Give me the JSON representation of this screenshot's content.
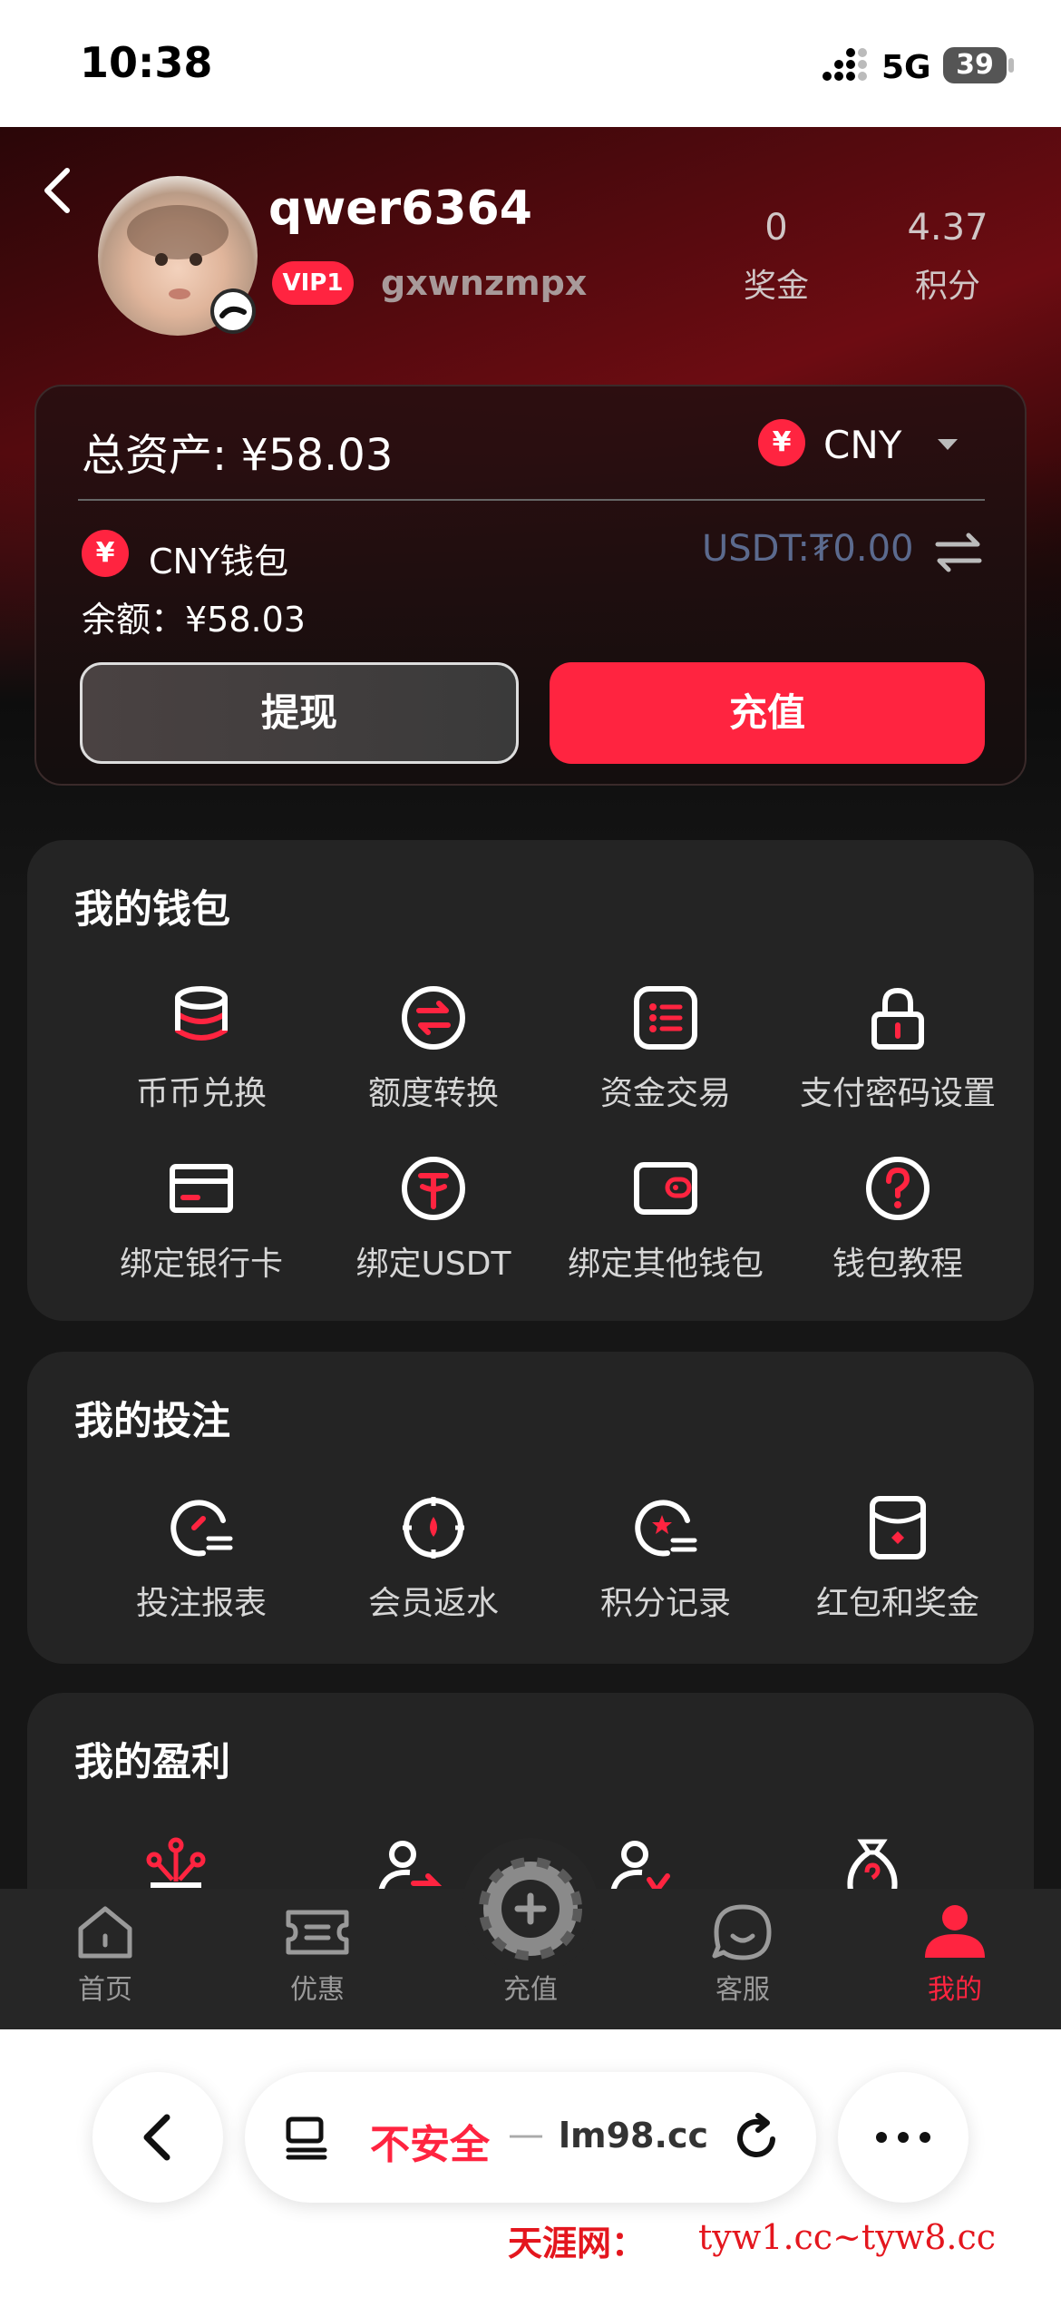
{
  "status": {
    "time": "10:38",
    "network": "5G",
    "battery": "39"
  },
  "profile": {
    "username": "qwer6364",
    "vip": "VIP1",
    "handle": "gxwnzmpx",
    "bonus_value": "0",
    "bonus_label": "奖金",
    "points_value": "4.37",
    "points_label": "积分"
  },
  "assets": {
    "total_label": "总资产: ¥58.03",
    "currency_symbol": "¥",
    "currency": "CNY",
    "wallet_name": "CNY钱包",
    "usdt": "USDT:₮0.00",
    "balance": "余额：¥58.03",
    "withdraw": "提现",
    "deposit": "充值"
  },
  "wallet": {
    "title": "我的钱包",
    "items": [
      {
        "label": "币币兑换"
      },
      {
        "label": "额度转换"
      },
      {
        "label": "资金交易"
      },
      {
        "label": "支付密码设置"
      },
      {
        "label": "绑定银行卡"
      },
      {
        "label": "绑定USDT"
      },
      {
        "label": "绑定其他钱包"
      },
      {
        "label": "钱包教程"
      }
    ]
  },
  "bets": {
    "title": "我的投注",
    "items": [
      {
        "label": "投注报表"
      },
      {
        "label": "会员返水"
      },
      {
        "label": "积分记录"
      },
      {
        "label": "红包和奖金"
      }
    ]
  },
  "profit": {
    "title": "我的盈利"
  },
  "tabs": [
    {
      "label": "首页"
    },
    {
      "label": "优惠"
    },
    {
      "label": "充值"
    },
    {
      "label": "客服"
    },
    {
      "label": "我的"
    }
  ],
  "browser": {
    "insecure": "不安全",
    "dash": "—",
    "domain": "lm98.cc"
  },
  "watermark": {
    "site": "天涯网：",
    "urls": "tyw1.cc~tyw8.cc"
  },
  "colors": {
    "accent": "#ff2440",
    "usdt": "#5b6a8e"
  }
}
